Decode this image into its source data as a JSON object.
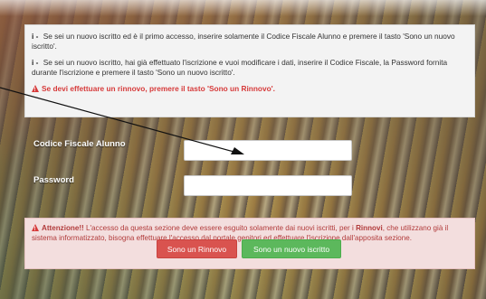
{
  "info": {
    "line1_prefix": "i - ",
    "line1": "Se sei un nuovo iscritto ed è il primo accesso, inserire solamente il Codice Fiscale Alunno e premere il tasto 'Sono un nuovo iscritto'.",
    "line2_prefix": "i - ",
    "line2": "Se sei un nuovo iscritto, hai già effettuato l'iscrizione e vuoi modificare i dati, inserire il Codice Fiscale, la Password fornita durante l'iscrizione e premere il tasto 'Sono un nuovo iscritto'.",
    "warning": "Se devi effettuare un rinnovo, premere il tasto 'Sono un Rinnovo'."
  },
  "form": {
    "codice_label": "Codice Fiscale Alunno",
    "codice_value": "",
    "password_label": "Password",
    "password_value": ""
  },
  "alert": {
    "title": "Attenzione!!",
    "text": " L'accesso da questa sezione deve essere esguito solamente dai nuovi iscritti, per i ",
    "bold": "Rinnovi",
    "text2": ", che utilizzano già il sistema informatizzato, bisogna effettuare l'accesso dal portale genitori ed effettuare l'iscrizione dall'apposita sezione."
  },
  "buttons": {
    "rinnovo": "Sono un Rinnovo",
    "nuovo": "Sono un nuovo iscritto"
  },
  "colors": {
    "danger": "#d9534f",
    "success": "#5cb85c",
    "alert_bg": "#f3dede"
  }
}
